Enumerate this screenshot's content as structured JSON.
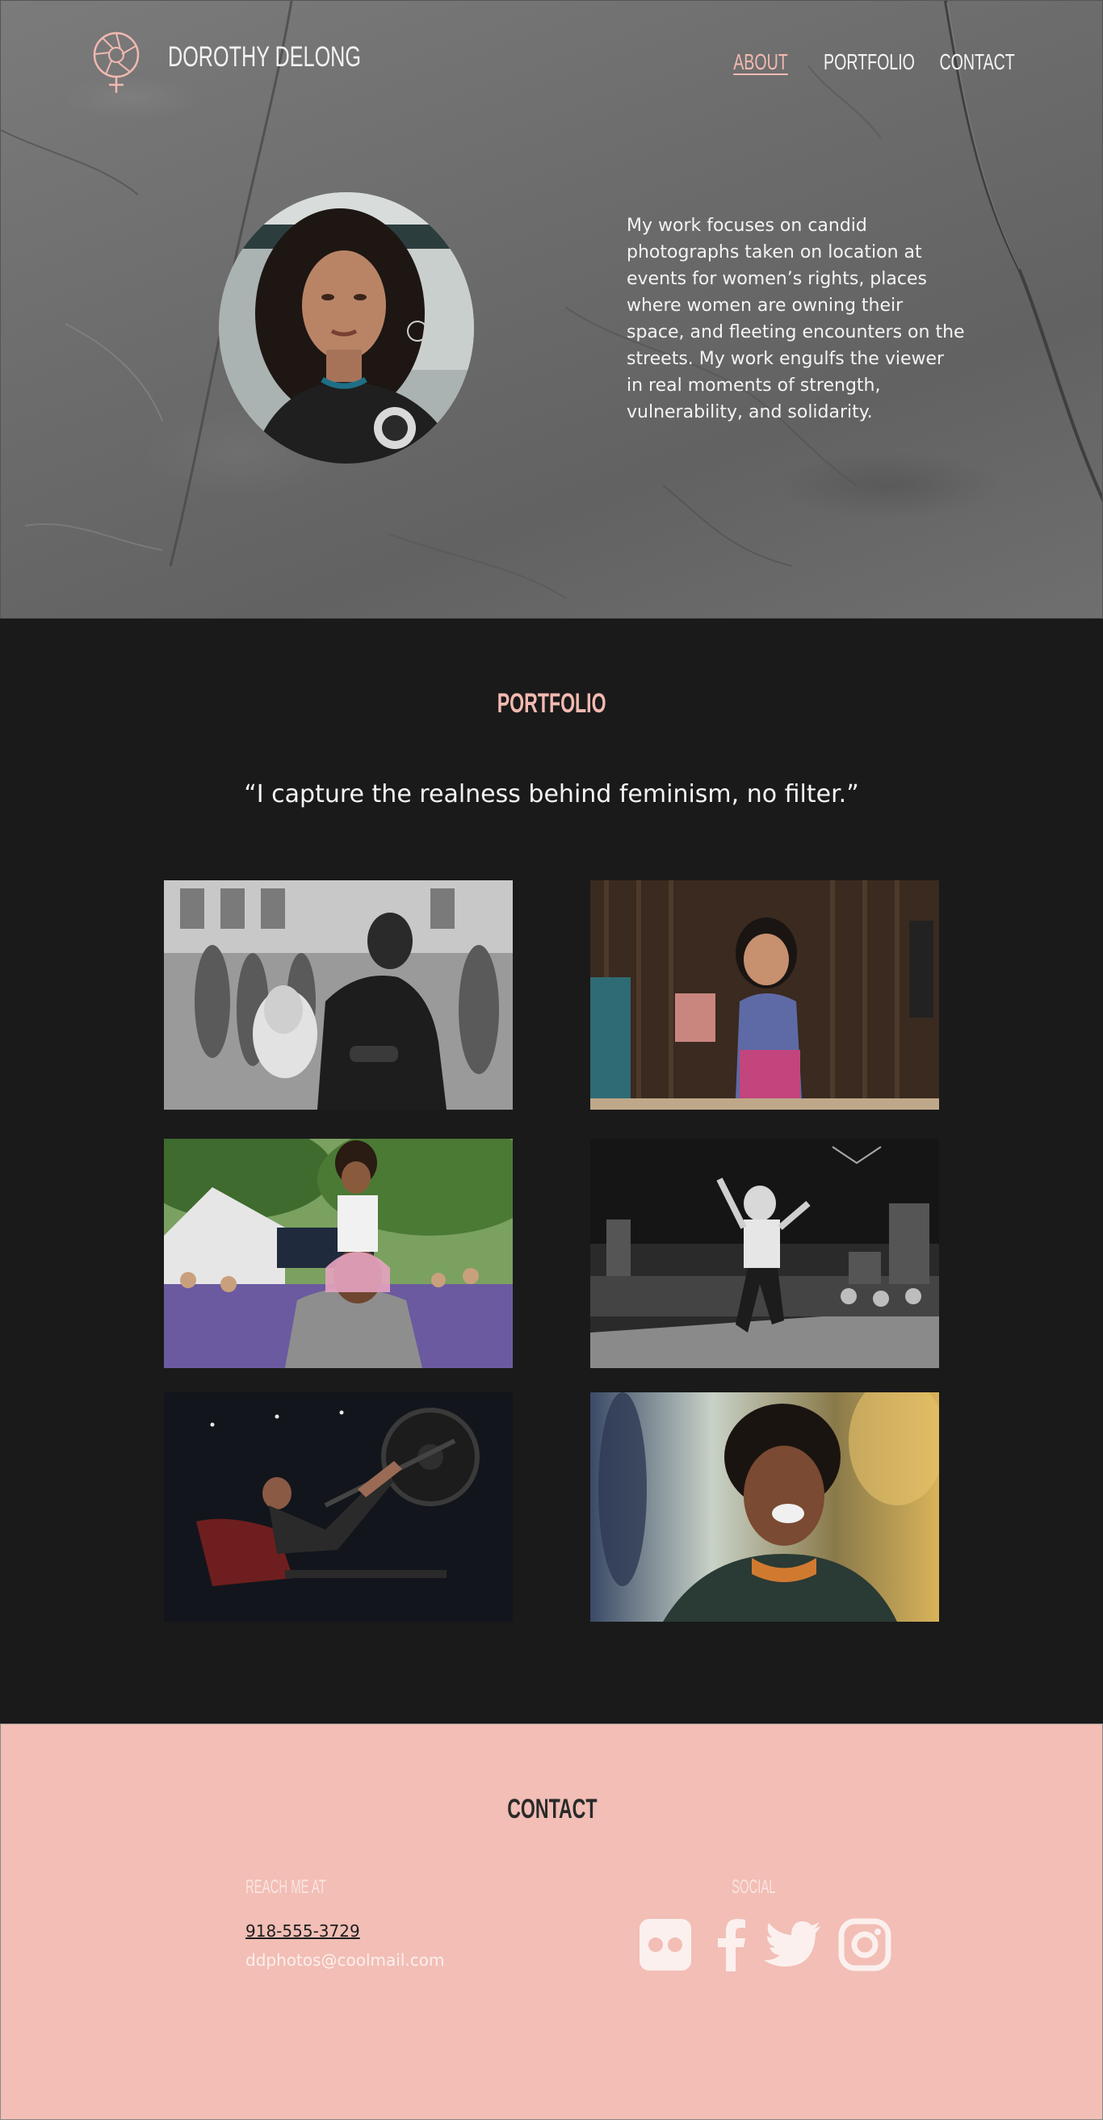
{
  "header": {
    "brand_name": "DOROTHY DELONG",
    "nav": [
      {
        "label": "ABOUT",
        "active": true
      },
      {
        "label": "PORTFOLIO",
        "active": false
      },
      {
        "label": "CONTACT",
        "active": false
      }
    ],
    "logo_icon": "aperture-venus-icon"
  },
  "about": {
    "text": "My work focuses on candid photographs taken on location at events for women’s rights, places where women are owning their space, and fleeting encounters on the streets. My work engulfs the viewer in real moments of strength, vulnerability, and solidarity."
  },
  "portfolio": {
    "title": "PORTFOLIO",
    "quote": "“I capture the realness behind feminism, no filter.”",
    "photos": [
      {
        "name": "photo-barber-street",
        "tone": "monochrome"
      },
      {
        "name": "photo-girl-smiling",
        "tone": "color"
      },
      {
        "name": "photo-father-daughter",
        "tone": "color"
      },
      {
        "name": "photo-stage-dancer",
        "tone": "monochrome"
      },
      {
        "name": "photo-gym-legpress",
        "tone": "color"
      },
      {
        "name": "photo-woman-laughing",
        "tone": "color"
      }
    ]
  },
  "contact": {
    "title": "CONTACT",
    "reach_label": "REACH ME AT",
    "phone": "918-555-3729",
    "email": "ddphotos@coolmail.com",
    "social_label": "SOCIAL",
    "social_icons": [
      "flickr-icon",
      "facebook-icon",
      "twitter-icon",
      "instagram-icon"
    ]
  },
  "colors": {
    "accent_pink": "#f2b9b0",
    "contact_bg": "#f2beb5",
    "dark_bg": "#1a1a1a",
    "hero_gray": "#6e6e6e"
  }
}
